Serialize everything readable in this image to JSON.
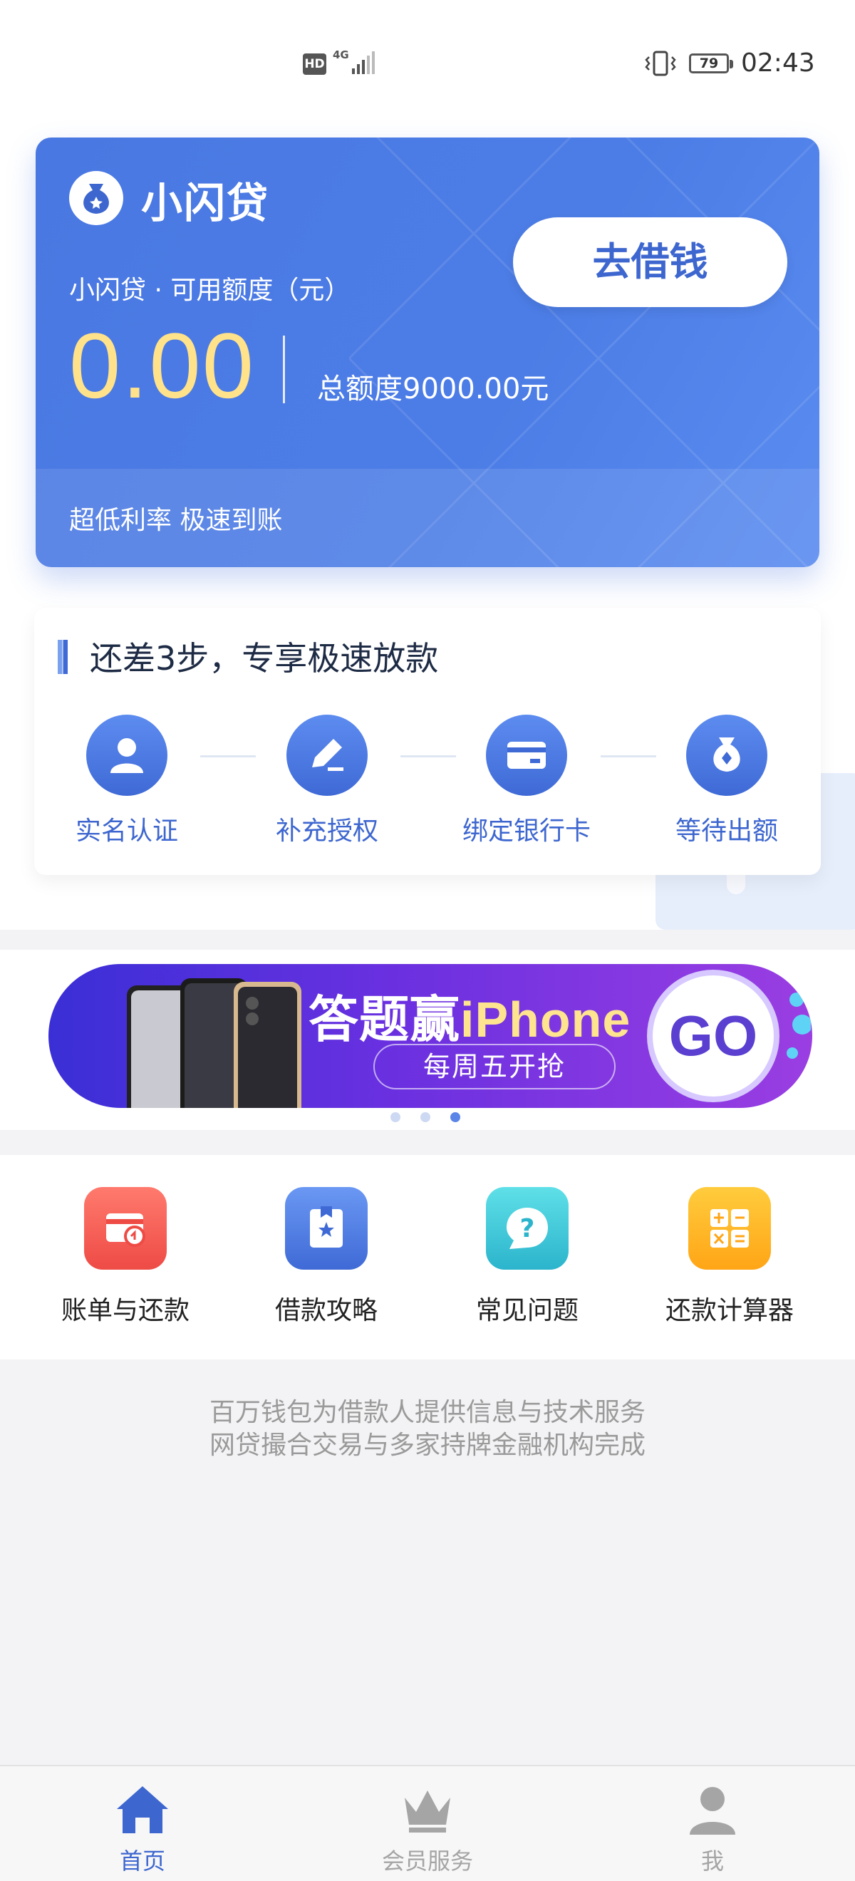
{
  "status_bar": {
    "hd": "HD",
    "network": "4G",
    "battery": "79",
    "time": "02:43"
  },
  "hero": {
    "brand": "小闪贷",
    "available_label": "小闪贷 · 可用额度（元）",
    "amount": "0.00",
    "total": "总额度9000.00元",
    "borrow_button": "去借钱",
    "slogan": "超低利率  极速到账"
  },
  "steps": {
    "title": "还差3步，专享极速放款",
    "items": [
      {
        "label": "实名认证",
        "icon": "person-icon"
      },
      {
        "label": "补充授权",
        "icon": "edit-icon"
      },
      {
        "label": "绑定银行卡",
        "icon": "card-icon"
      },
      {
        "label": "等待出额",
        "icon": "money-bag-icon"
      }
    ]
  },
  "banner": {
    "headline_cn": "答题赢",
    "headline_en": "iPhone",
    "sub": "每周五开抢",
    "go": "GO",
    "slide_count": 3,
    "active_slide": 3
  },
  "tools": [
    {
      "label": "账单与还款",
      "icon": "bill-icon",
      "color": "#f05a4f"
    },
    {
      "label": "借款攻略",
      "icon": "guide-icon",
      "color": "#4d7fe8"
    },
    {
      "label": "常见问题",
      "icon": "question-icon",
      "color": "#36c5d6"
    },
    {
      "label": "还款计算器",
      "icon": "calculator-icon",
      "color": "#ffb21c"
    }
  ],
  "disclaimer": {
    "line1": "百万钱包为借款人提供信息与技术服务",
    "line2": "网贷撮合交易与多家持牌金融机构完成"
  },
  "tabbar": {
    "items": [
      {
        "label": "首页",
        "icon": "home-icon",
        "active": true
      },
      {
        "label": "会员服务",
        "icon": "crown-icon",
        "active": false
      },
      {
        "label": "我",
        "icon": "user-icon",
        "active": false
      }
    ]
  },
  "colors": {
    "primary": "#4a78e2",
    "amount": "#ffe28a",
    "tab_active": "#3d66cf",
    "tab_inactive": "#a5a5a5"
  }
}
